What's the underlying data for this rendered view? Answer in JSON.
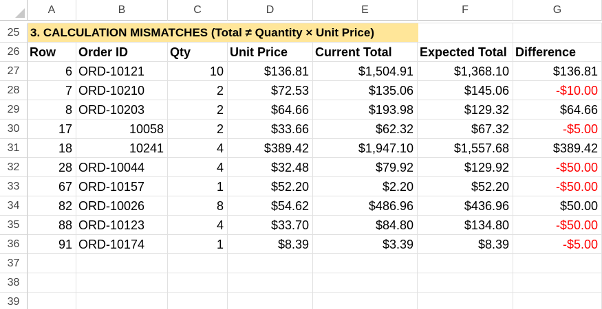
{
  "columns": [
    "A",
    "B",
    "C",
    "D",
    "E",
    "F",
    "G"
  ],
  "row_numbers": [
    "25",
    "26",
    "27",
    "28",
    "29",
    "30",
    "31",
    "32",
    "33",
    "34",
    "35",
    "36",
    "37",
    "38",
    "39"
  ],
  "section_title": "3. CALCULATION MISMATCHES (Total ≠ Quantity × Unit Price)",
  "table_headers": [
    "Row",
    "Order ID",
    "Qty",
    "Unit Price",
    "Current Total",
    "Expected Total",
    "Difference"
  ],
  "rows": [
    {
      "row": "6",
      "order_id": "ORD-10121",
      "qty": "10",
      "unit_price": "$136.81",
      "current_total": "$1,504.91",
      "expected_total": "$1,368.10",
      "difference": "$136.81",
      "negative": false,
      "order_numeric": false
    },
    {
      "row": "7",
      "order_id": "ORD-10210",
      "qty": "2",
      "unit_price": "$72.53",
      "current_total": "$135.06",
      "expected_total": "$145.06",
      "difference": "-$10.00",
      "negative": true,
      "order_numeric": false
    },
    {
      "row": "8",
      "order_id": "ORD-10203",
      "qty": "2",
      "unit_price": "$64.66",
      "current_total": "$193.98",
      "expected_total": "$129.32",
      "difference": "$64.66",
      "negative": false,
      "order_numeric": false
    },
    {
      "row": "17",
      "order_id": "10058",
      "qty": "2",
      "unit_price": "$33.66",
      "current_total": "$62.32",
      "expected_total": "$67.32",
      "difference": "-$5.00",
      "negative": true,
      "order_numeric": true
    },
    {
      "row": "18",
      "order_id": "10241",
      "qty": "4",
      "unit_price": "$389.42",
      "current_total": "$1,947.10",
      "expected_total": "$1,557.68",
      "difference": "$389.42",
      "negative": false,
      "order_numeric": true
    },
    {
      "row": "28",
      "order_id": "ORD-10044",
      "qty": "4",
      "unit_price": "$32.48",
      "current_total": "$79.92",
      "expected_total": "$129.92",
      "difference": "-$50.00",
      "negative": true,
      "order_numeric": false
    },
    {
      "row": "67",
      "order_id": "ORD-10157",
      "qty": "1",
      "unit_price": "$52.20",
      "current_total": "$2.20",
      "expected_total": "$52.20",
      "difference": "-$50.00",
      "negative": true,
      "order_numeric": false
    },
    {
      "row": "82",
      "order_id": "ORD-10026",
      "qty": "8",
      "unit_price": "$54.62",
      "current_total": "$486.96",
      "expected_total": "$436.96",
      "difference": "$50.00",
      "negative": false,
      "order_numeric": false
    },
    {
      "row": "88",
      "order_id": "ORD-10123",
      "qty": "4",
      "unit_price": "$33.70",
      "current_total": "$84.80",
      "expected_total": "$134.80",
      "difference": "-$50.00",
      "negative": true,
      "order_numeric": false
    },
    {
      "row": "91",
      "order_id": "ORD-10174",
      "qty": "1",
      "unit_price": "$8.39",
      "current_total": "$3.39",
      "expected_total": "$8.39",
      "difference": "-$5.00",
      "negative": true,
      "order_numeric": false
    }
  ],
  "colors": {
    "banner_fill": "#ffe699",
    "negative_text": "#ff0000",
    "gridline": "#e1e1e1"
  }
}
